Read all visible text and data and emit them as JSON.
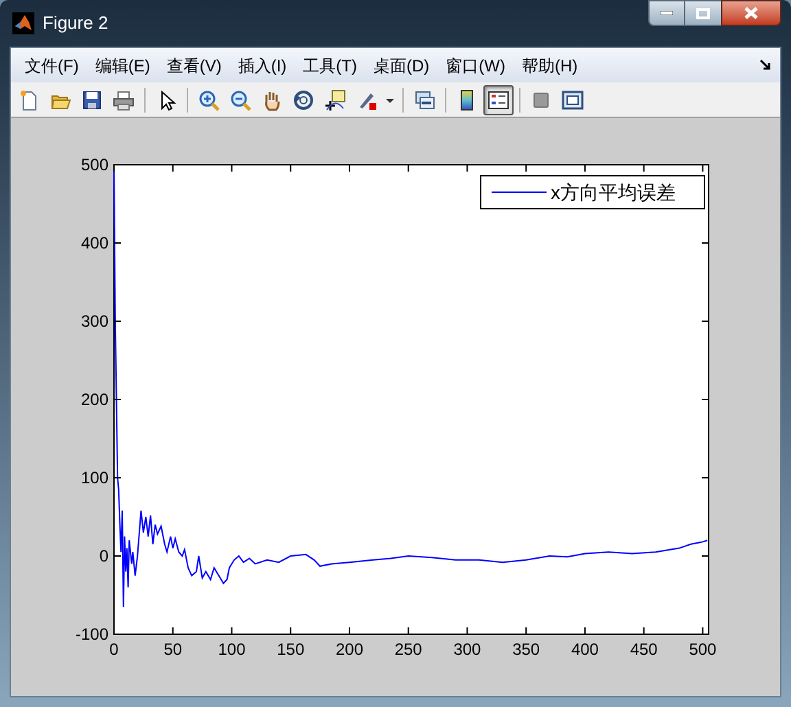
{
  "window": {
    "title": "Figure 2"
  },
  "menu": [
    "文件(F)",
    "编辑(E)",
    "查看(V)",
    "插入(I)",
    "工具(T)",
    "桌面(D)",
    "窗口(W)",
    "帮助(H)"
  ],
  "toolbar": [
    {
      "selected": false
    },
    {
      "selected": false
    },
    {
      "selected": false
    },
    {
      "selected": false
    },
    {
      "selected": false
    },
    {
      "selected": false
    },
    {
      "selected": false
    },
    {
      "selected": false
    },
    {
      "selected": false
    },
    {
      "selected": false
    },
    {
      "selected": false
    },
    {
      "selected": false
    },
    {
      "selected": false
    },
    {
      "selected": true
    },
    {
      "selected": false
    },
    {
      "selected": false
    }
  ],
  "chart_data": {
    "type": "line",
    "xlim": [
      0,
      505
    ],
    "ylim": [
      -100,
      500
    ],
    "xticks": [
      0,
      50,
      100,
      150,
      200,
      250,
      300,
      350,
      400,
      450,
      500
    ],
    "yticks": [
      -100,
      0,
      100,
      200,
      300,
      400,
      500
    ],
    "x": [
      0,
      1,
      3,
      4,
      5,
      6,
      7,
      8,
      9,
      10,
      11,
      12,
      13,
      15,
      16,
      18,
      20,
      22,
      23,
      25,
      27,
      29,
      31,
      33,
      35,
      37,
      40,
      43,
      45,
      48,
      50,
      52,
      55,
      58,
      60,
      63,
      66,
      70,
      72,
      75,
      78,
      82,
      85,
      89,
      93,
      96,
      98,
      102,
      106,
      110,
      115,
      120,
      130,
      140,
      150,
      163,
      170,
      175,
      185,
      200,
      220,
      235,
      250,
      270,
      290,
      310,
      330,
      350,
      370,
      385,
      400,
      420,
      440,
      460,
      480,
      490,
      500,
      504
    ],
    "series": [
      {
        "name": "x方向平均误差",
        "color": "#0000ff",
        "values": [
          500,
          305,
          100,
          85,
          40,
          5,
          58,
          -65,
          25,
          -20,
          10,
          -40,
          20,
          -10,
          5,
          -25,
          0,
          40,
          58,
          30,
          50,
          25,
          52,
          15,
          40,
          28,
          38,
          15,
          5,
          25,
          10,
          22,
          5,
          0,
          8,
          -15,
          -25,
          -20,
          0,
          -28,
          -20,
          -30,
          -15,
          -25,
          -35,
          -30,
          -15,
          -5,
          0,
          -8,
          -3,
          -10,
          -5,
          -8,
          0,
          2,
          -5,
          -13,
          -10,
          -8,
          -5,
          -3,
          0,
          -2,
          -5,
          -5,
          -8,
          -5,
          0,
          -1,
          3,
          5,
          3,
          5,
          10,
          15,
          18,
          20
        ]
      }
    ]
  }
}
